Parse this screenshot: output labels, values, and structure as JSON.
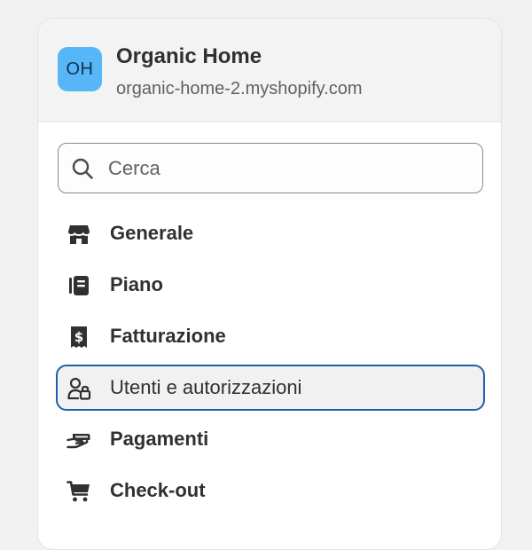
{
  "store": {
    "avatar_initials": "OH",
    "name": "Organic Home",
    "domain": "organic-home-2.myshopify.com"
  },
  "search": {
    "placeholder": "Cerca",
    "value": ""
  },
  "nav": {
    "items": [
      {
        "label": "Generale",
        "icon": "store-icon",
        "active": false
      },
      {
        "label": "Piano",
        "icon": "plan-icon",
        "active": false
      },
      {
        "label": "Fatturazione",
        "icon": "receipt-dollar-icon",
        "active": false
      },
      {
        "label": "Utenti e autorizzazioni",
        "icon": "users-lock-icon",
        "active": true
      },
      {
        "label": "Pagamenti",
        "icon": "payment-hand-icon",
        "active": false
      },
      {
        "label": "Check-out",
        "icon": "cart-icon",
        "active": false
      }
    ]
  },
  "colors": {
    "avatar_bg": "#56b6f7",
    "active_border": "#1e5fad",
    "text": "#303030",
    "muted_text": "#616161"
  }
}
